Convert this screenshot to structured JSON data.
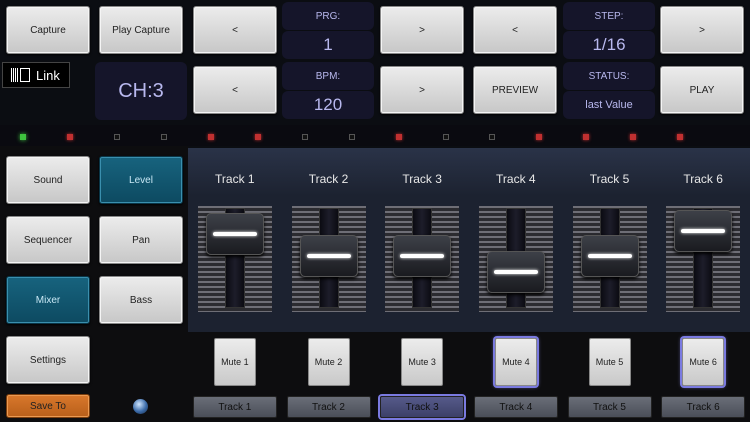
{
  "top_row": {
    "capture": "Capture",
    "play_capture": "Play Capture",
    "prev1": "<",
    "prg_label": "PRG:",
    "prg_value": "1",
    "next1": ">",
    "prev2": "<",
    "step_label": "STEP:",
    "step_value": "1/16",
    "next2": ">"
  },
  "second_row": {
    "link_label": "Link",
    "channel": "CH:3",
    "prev_bpm": "<",
    "bpm_label": "BPM:",
    "bpm_value": "120",
    "next_bpm": ">",
    "preview": "PREVIEW",
    "status_label": "STATUS:",
    "status_value": "last Value",
    "play": "PLAY"
  },
  "side_menu": {
    "sound": "Sound",
    "level": "Level",
    "sequencer": "Sequencer",
    "pan": "Pan",
    "mixer": "Mixer",
    "bass": "Bass",
    "settings": "Settings",
    "save_to": "Save To"
  },
  "tracks": [
    {
      "name": "Track 1",
      "mute": "Mute 1",
      "select": "Track 1",
      "muted": false,
      "level": 0.8
    },
    {
      "name": "Track 2",
      "mute": "Mute 2",
      "select": "Track 2",
      "muted": false,
      "level": 0.45
    },
    {
      "name": "Track 3",
      "mute": "Mute 3",
      "select": "Track 3",
      "muted": false,
      "level": 0.45
    },
    {
      "name": "Track 4",
      "mute": "Mute 4",
      "select": "Track 4",
      "muted": true,
      "level": 0.2
    },
    {
      "name": "Track 5",
      "mute": "Mute 5",
      "select": "Track 5",
      "muted": false,
      "level": 0.45
    },
    {
      "name": "Track 6",
      "mute": "Mute 6",
      "select": "Track 6",
      "muted": true,
      "level": 0.85
    }
  ],
  "selected_track": "Track 3",
  "leds": [
    "green",
    "red",
    "off",
    "off",
    "red",
    "red",
    "off",
    "off",
    "red",
    "off",
    "off",
    "red",
    "red",
    "red",
    "red"
  ],
  "colors": {
    "accent_teal": "#135a73",
    "orange": "#c86a22",
    "lcd_text": "#b8b8ee",
    "led_green": "#3ec43e",
    "led_red": "#c03030"
  }
}
